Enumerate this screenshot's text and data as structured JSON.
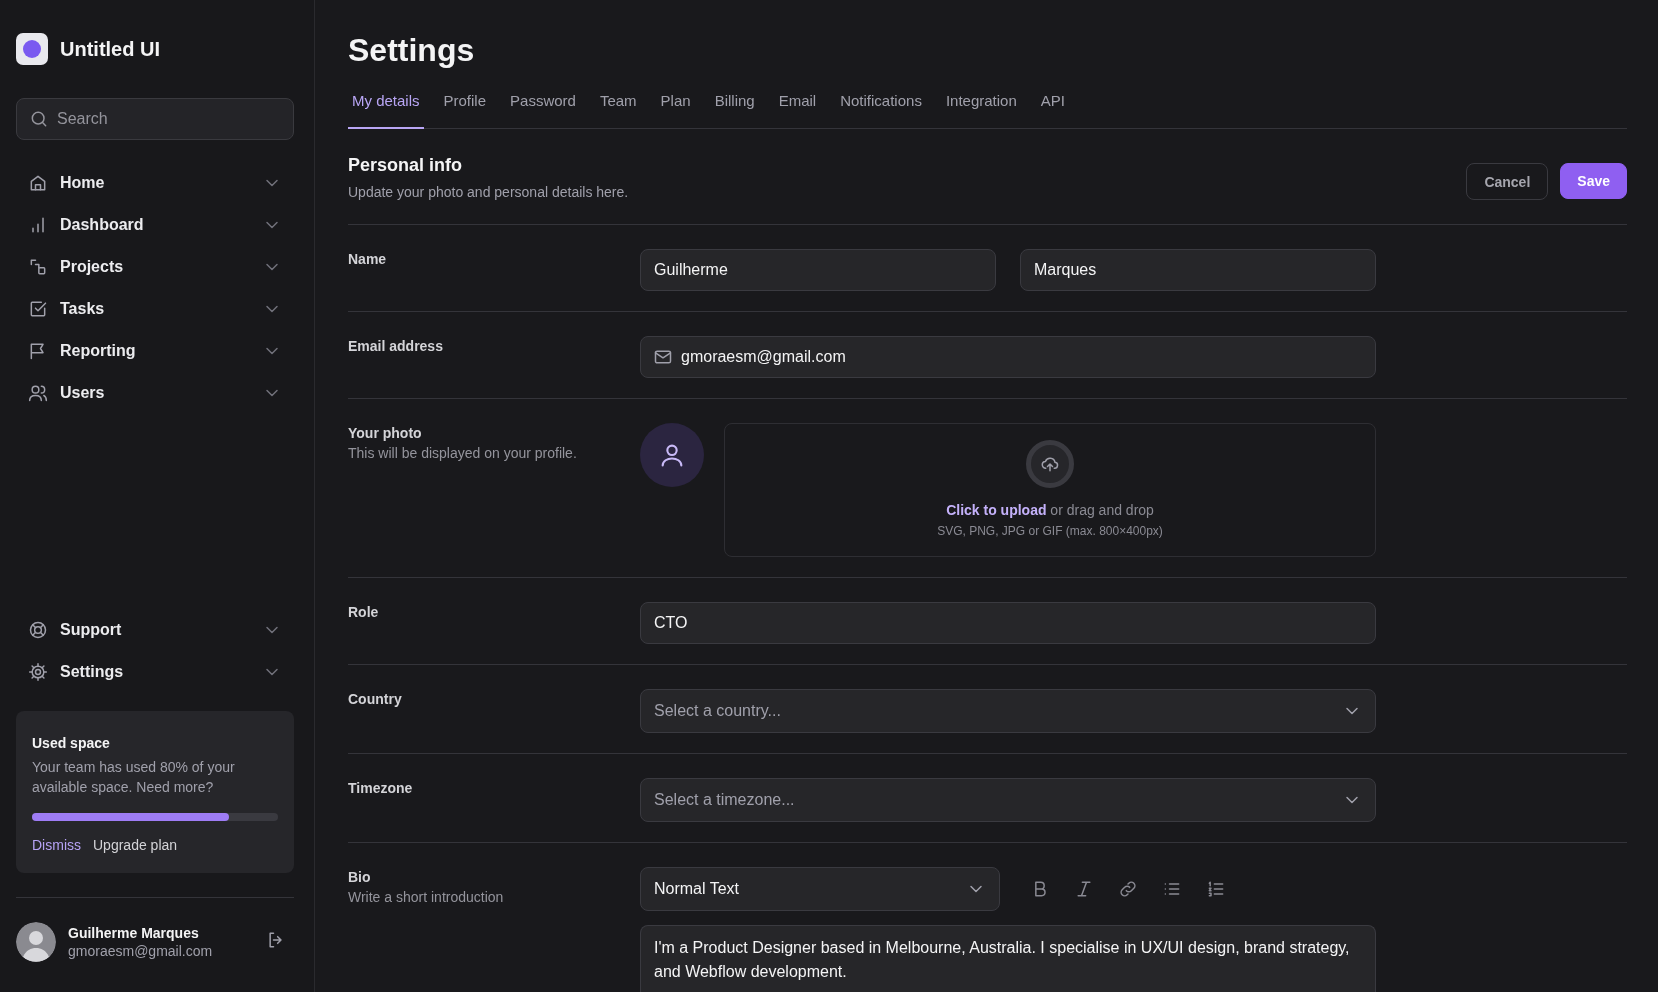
{
  "brand": {
    "name": "Untitled UI"
  },
  "search": {
    "placeholder": "Search"
  },
  "nav": [
    {
      "label": "Home",
      "kind": "home"
    },
    {
      "label": "Dashboard",
      "kind": "dashboard"
    },
    {
      "label": "Projects",
      "kind": "projects"
    },
    {
      "label": "Tasks",
      "kind": "tasks"
    },
    {
      "label": "Reporting",
      "kind": "reporting"
    },
    {
      "label": "Users",
      "kind": "users"
    }
  ],
  "nav_bottom": [
    {
      "label": "Support",
      "kind": "support"
    },
    {
      "label": "Settings",
      "kind": "settings"
    }
  ],
  "usage_card": {
    "title": "Used space",
    "text": "Your team has used 80% of your available space. Need more?",
    "level": 0.8,
    "actions": [
      {
        "label": "Dismiss",
        "kind": "link"
      },
      {
        "label": "Upgrade plan",
        "kind": "plain"
      }
    ]
  },
  "user": {
    "name": "Guilherme Marques",
    "email": "gmoraesm@gmail.com"
  },
  "page": {
    "title": "Settings"
  },
  "tabs": [
    {
      "label": "My details",
      "selected": true
    },
    {
      "label": "Profile",
      "selected": false
    },
    {
      "label": "Password",
      "selected": false
    },
    {
      "label": "Team",
      "selected": false
    },
    {
      "label": "Plan",
      "selected": false
    },
    {
      "label": "Billing",
      "selected": false
    },
    {
      "label": "Email",
      "selected": false
    },
    {
      "label": "Notifications",
      "selected": false
    },
    {
      "label": "Integration",
      "selected": false
    },
    {
      "label": "API",
      "selected": false
    }
  ],
  "section": {
    "title": "Personal info",
    "subtitle": "Update your photo and personal details here.",
    "buttons": [
      {
        "label": "Cancel",
        "kind": "secondary"
      },
      {
        "label": "Save",
        "kind": "primary"
      }
    ]
  },
  "rows": [
    {
      "label": "Name",
      "kind": "name",
      "values": [
        "Guilherme",
        "Marques"
      ]
    },
    {
      "label": "Email address",
      "kind": "email",
      "value": "gmoraesm@gmail.com"
    },
    {
      "label": "Your photo",
      "hint": "This will be displayed on your profile.",
      "kind": "photo",
      "upload": {
        "link": "Click to upload",
        "text": "or drag and drop",
        "note": "SVG, PNG, JPG or GIF (max. 800×400px)"
      }
    },
    {
      "label": "Role",
      "kind": "text",
      "value": "CTO"
    },
    {
      "label": "Country",
      "kind": "select",
      "placeholder": "Select a country..."
    },
    {
      "label": "Timezone",
      "kind": "select",
      "placeholder": "Select a timezone..."
    },
    {
      "label": "Bio",
      "hint": "Write a short introduction",
      "kind": "bio",
      "text_style": "Normal Text",
      "tools": [
        {
          "kind": "bold"
        },
        {
          "kind": "italic"
        },
        {
          "kind": "link"
        },
        {
          "kind": "bullets"
        },
        {
          "kind": "numbers"
        }
      ],
      "value": "I'm a Product Designer based in Melbourne, Australia. I specialise in UX/UI design, brand strategy, and Webflow development."
    }
  ]
}
